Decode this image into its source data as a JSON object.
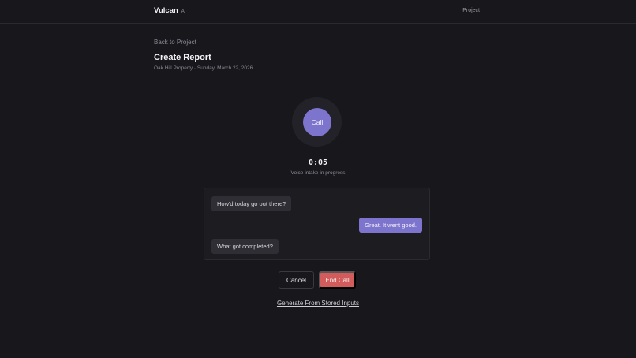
{
  "header": {
    "brand_name": "Vulcan",
    "brand_tag": "AI",
    "nav_project": "Project"
  },
  "page": {
    "back_link": "Back to Project",
    "title": "Create Report",
    "subtitle": "Oak Hill Property · Sunday, March 22, 2026"
  },
  "call": {
    "button_label": "Call",
    "timer": "0:05",
    "status": "Voice intake in progress"
  },
  "transcript": {
    "messages": [
      {
        "role": "agent",
        "text": "How'd today go out there?"
      },
      {
        "role": "user",
        "text": "Great. It went good."
      },
      {
        "role": "agent",
        "text": "What got completed?"
      }
    ]
  },
  "actions": {
    "cancel_label": "Cancel",
    "end_call_label": "End Call",
    "generate_link": "Generate From Stored Inputs"
  },
  "colors": {
    "accent": "#7d74cd",
    "danger": "#d25b5b",
    "background": "#18171b"
  }
}
